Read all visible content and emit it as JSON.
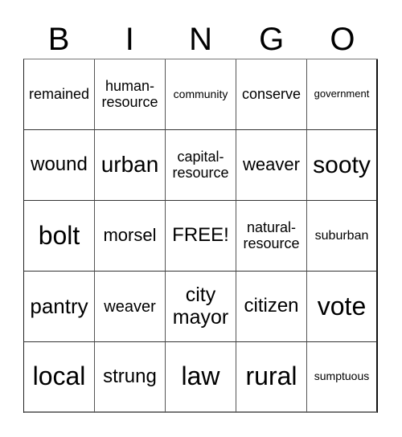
{
  "header": [
    "B",
    "I",
    "N",
    "G",
    "O"
  ],
  "cells": [
    {
      "text": "remained",
      "size": 18
    },
    {
      "text": "human-\nresource",
      "size": 18
    },
    {
      "text": "community",
      "size": 14
    },
    {
      "text": "conserve",
      "size": 18
    },
    {
      "text": "government",
      "size": 13
    },
    {
      "text": "wound",
      "size": 24
    },
    {
      "text": "urban",
      "size": 28
    },
    {
      "text": "capital-\nresource",
      "size": 18
    },
    {
      "text": "weaver",
      "size": 22
    },
    {
      "text": "sooty",
      "size": 30
    },
    {
      "text": "bolt",
      "size": 32
    },
    {
      "text": "morsel",
      "size": 22
    },
    {
      "text": "FREE!",
      "size": 24
    },
    {
      "text": "natural-\nresource",
      "size": 18
    },
    {
      "text": "suburban",
      "size": 16
    },
    {
      "text": "pantry",
      "size": 26
    },
    {
      "text": "weaver",
      "size": 20
    },
    {
      "text": "city\nmayor",
      "size": 25
    },
    {
      "text": "citizen",
      "size": 24
    },
    {
      "text": "vote",
      "size": 32
    },
    {
      "text": "local",
      "size": 32
    },
    {
      "text": "strung",
      "size": 24
    },
    {
      "text": "law",
      "size": 32
    },
    {
      "text": "rural",
      "size": 32
    },
    {
      "text": "sumptuous",
      "size": 14
    }
  ]
}
